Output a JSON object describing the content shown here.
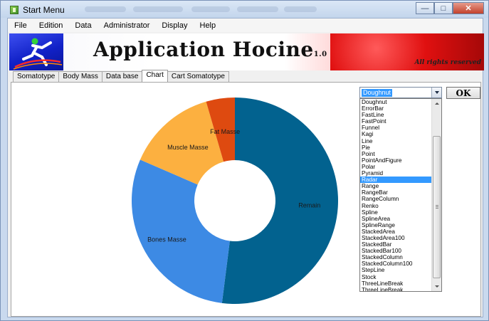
{
  "window": {
    "title": "Start Menu",
    "controls": {
      "minimize": "—",
      "maximize": "□",
      "close": "✕"
    }
  },
  "menu": [
    "File",
    "Edition",
    "Data",
    "Administrator",
    "Display",
    "Help"
  ],
  "banner": {
    "title": "Application Hocine",
    "version": "1.0",
    "rights": "All rights reserved"
  },
  "tabs": [
    {
      "label": "Somatotype",
      "active": false
    },
    {
      "label": "Body Mass",
      "active": false
    },
    {
      "label": "Data base",
      "active": false
    },
    {
      "label": "Chart",
      "active": true
    },
    {
      "label": "Cart Somatotype",
      "active": false
    }
  ],
  "chart_type_select": {
    "value": "Doughnut",
    "options": [
      "Doughnut",
      "ErrorBar",
      "FastLine",
      "FastPoint",
      "Funnel",
      "Kagi",
      "Line",
      "Pie",
      "Point",
      "PointAndFigure",
      "Polar",
      "Pyramid",
      "Radar",
      "Range",
      "RangeBar",
      "RangeColumn",
      "Renko",
      "Spline",
      "SplineArea",
      "SplineRange",
      "StackedArea",
      "StackedArea100",
      "StackedBar",
      "StackedBar100",
      "StackedColumn",
      "StackedColumn100",
      "StepLine",
      "Stock",
      "ThreeLineBreak",
      "ThreeLineBreak"
    ],
    "highlighted": "Radar"
  },
  "ok_button": "OK",
  "chart_data": {
    "type": "pie",
    "subtype": "doughnut",
    "title": "",
    "slices": [
      {
        "label": "Remain",
        "value": 52,
        "color": "#02628f"
      },
      {
        "label": "Bones Masse",
        "value": 29.5,
        "color": "#3d8ae4"
      },
      {
        "label": "Muscle Masse",
        "value": 14,
        "color": "#fcb040"
      },
      {
        "label": "Fat Masse",
        "value": 4.5,
        "color": "#de4a10"
      }
    ],
    "start_angle_deg": 270,
    "legend": "none"
  }
}
